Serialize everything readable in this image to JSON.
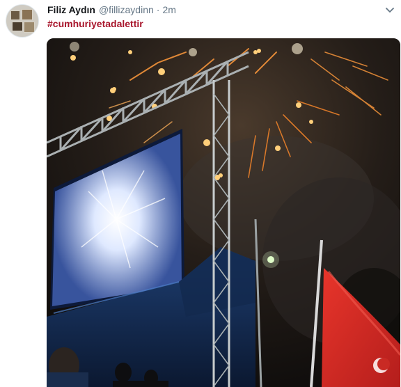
{
  "tweet": {
    "author_name": "Filiz Aydın",
    "author_handle": "@fillizaydinn",
    "separator": "·",
    "time": "2m",
    "hashtag": "#cumhuriyetadalettir"
  },
  "icons": {
    "menu": "chevron-down-icon",
    "avatar": "profile-photo"
  },
  "colors": {
    "hashtag": "#a8152b",
    "meta_text": "#657786",
    "name_text": "#14171a"
  }
}
